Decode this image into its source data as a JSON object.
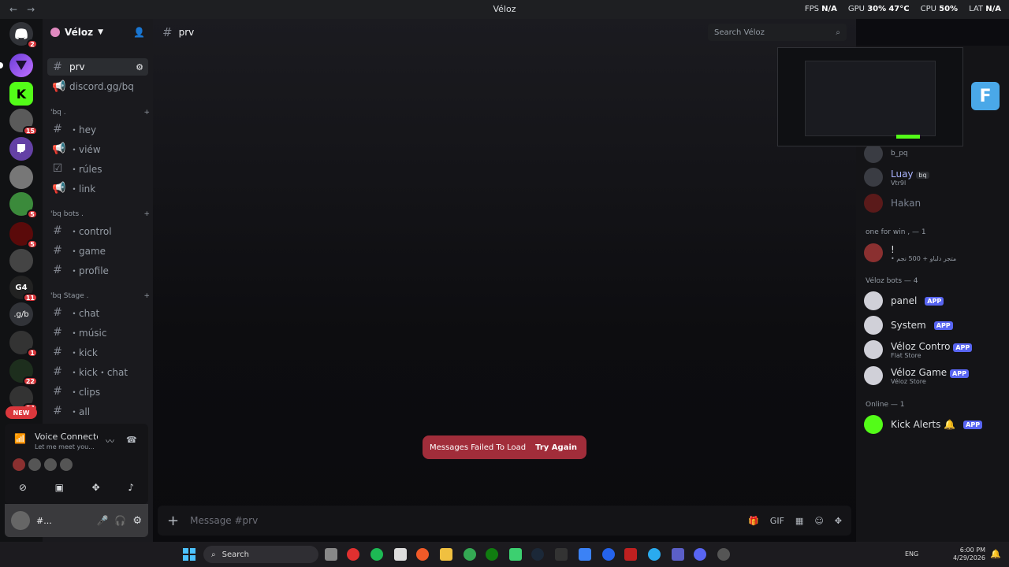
{
  "window": {
    "title": "Véloz",
    "back": "←",
    "forward": "→"
  },
  "perf": {
    "fps_label": "FPS",
    "fps": "N/A",
    "gpu_label": "GPU",
    "gpu": "30%",
    "gpu_temp": "47°C",
    "cpu_label": "CPU",
    "cpu": "50%",
    "lat_label": "LAT",
    "lat": "N/A"
  },
  "guilds": {
    "dm_badge": "2",
    "badges": [
      "15",
      "5",
      "5",
      "11",
      "1",
      "22",
      "84"
    ],
    "text_icon": ".g/b",
    "g4": "G4",
    "new": "NEW"
  },
  "server": {
    "name": "Véloz"
  },
  "channels": [
    {
      "name": "prv",
      "type": "text"
    },
    {
      "name": "discord.gg/bq",
      "type": "announce"
    }
  ],
  "categories": [
    {
      "name": "'bq .",
      "items": [
        "・hey",
        "・viéw",
        "・rúles",
        "・link"
      ]
    },
    {
      "name": "'bq bots .",
      "items": [
        "・control",
        "・game",
        "・profile"
      ]
    },
    {
      "name": "'bq Stage .",
      "items": [
        "・chat",
        "・músic",
        "・kick",
        "・kick・chat",
        "・clips",
        "・all"
      ]
    }
  ],
  "voice": {
    "title": "Voice Connected",
    "sub": "Let me meet you..."
  },
  "user": {
    "name": "#..."
  },
  "channel_header": {
    "name": "prv"
  },
  "search": {
    "placeholder": "Search Véloz"
  },
  "toast": {
    "message": "Messages Failed To Load",
    "action": "Try Again"
  },
  "composer": {
    "placeholder": "Message #prv"
  },
  "members": {
    "top": [
      {
        "name": "b_pq",
        "sub": ""
      },
      {
        "name": "Luay",
        "sub": "Vtr9l",
        "tag": "bq"
      },
      {
        "name": "Hakan",
        "sub": ""
      }
    ],
    "group1": {
      "title": "one for win , — 1",
      "items": [
        {
          "name": "!",
          "sub": "• متجر دلباو + 500 نجم"
        }
      ]
    },
    "group2": {
      "title": "Véloz bots — 4",
      "items": [
        {
          "name": "panel",
          "sub": ""
        },
        {
          "name": "System",
          "sub": ""
        },
        {
          "name": "Véloz Contro",
          "sub": "Flat Store"
        },
        {
          "name": "Véloz Game",
          "sub": "Véloz Store"
        }
      ]
    },
    "group3": {
      "title": "Online — 1",
      "items": [
        {
          "name": "Kick Alerts 🔔",
          "sub": ""
        }
      ]
    },
    "app_tag": "APP"
  },
  "taskbar": {
    "search": "Search",
    "lang": "ENG",
    "time": "6:00 PM",
    "date": "4/29/2026"
  },
  "colors": {
    "accent": "#5865f2",
    "danger": "#da373c",
    "toast": "#a12d3a",
    "kick": "#53fc18"
  }
}
